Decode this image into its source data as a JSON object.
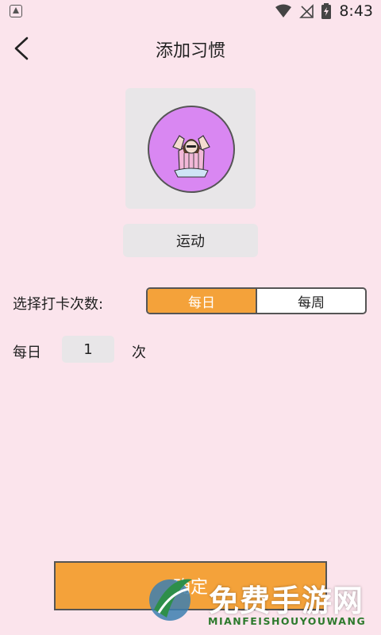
{
  "status_bar": {
    "time": "8:43",
    "icons": [
      "app-notification-icon",
      "wifi-icon",
      "no-signal-icon",
      "battery-charging-icon"
    ]
  },
  "header": {
    "title": "添加习惯",
    "back_icon": "chevron-left-icon"
  },
  "habit": {
    "icon": "person-cheering-icon",
    "icon_bg": "#d987f2",
    "name": "运动"
  },
  "frequency": {
    "label": "选择打卡次数:",
    "options": [
      "每日",
      "每周"
    ],
    "selected": "每日",
    "accent": "#f4a23a"
  },
  "count": {
    "prefix": "每日",
    "value": "1",
    "suffix": "次"
  },
  "confirm_label": "确定",
  "watermark": {
    "text": "免费手游网",
    "sub": "MIANFEISHOUYOUWANG"
  }
}
